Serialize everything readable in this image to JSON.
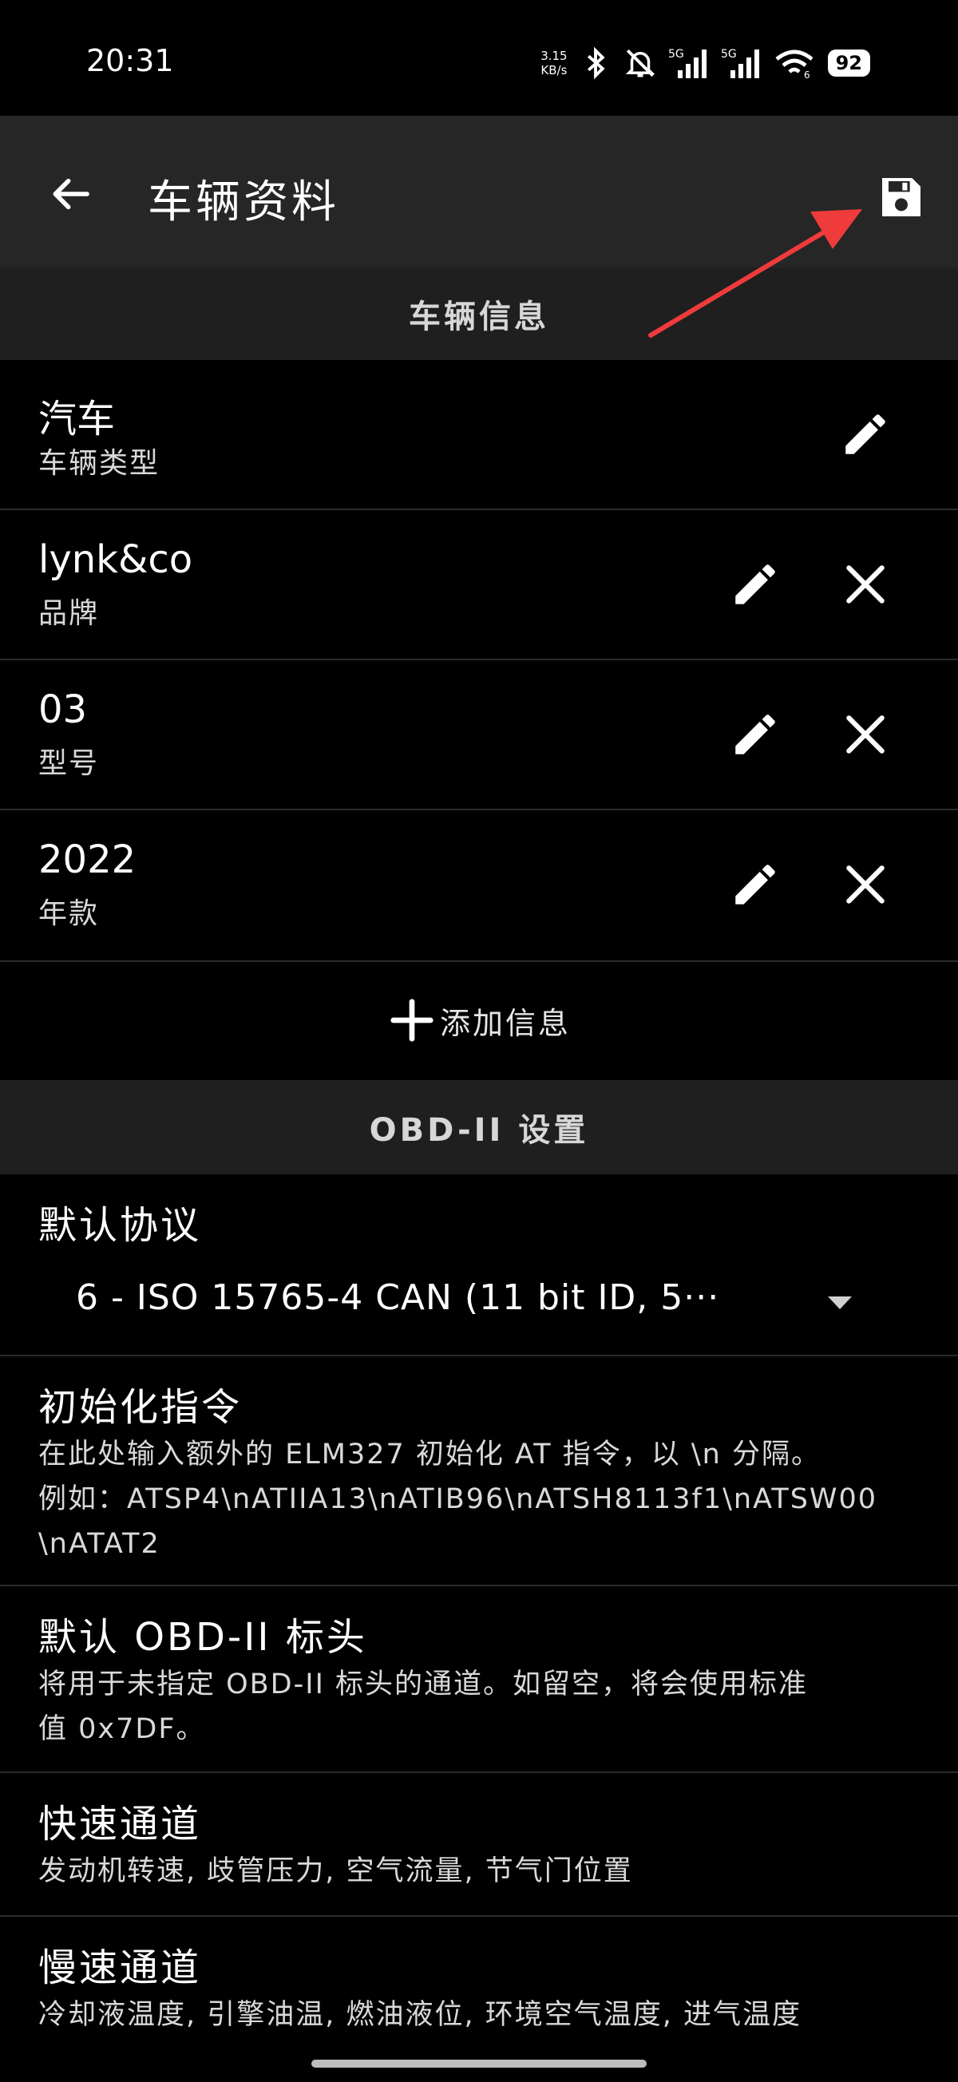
{
  "status_bar": {
    "time": "20:31",
    "net_speed_value": "3.15",
    "net_speed_unit": "KB/s",
    "network_1": "5G",
    "network_2": "5G",
    "wifi_sub": "6",
    "battery": "92"
  },
  "app_bar": {
    "title": "车辆资料",
    "back_icon": "arrow-left-icon",
    "save_icon": "floppy-disk-icon"
  },
  "vehicle_section": {
    "header": "车辆信息",
    "rows": [
      {
        "value": "汽车",
        "label": "车辆类型"
      },
      {
        "value": "lynk&co",
        "label": "品牌"
      },
      {
        "value": "03",
        "label": "型号"
      },
      {
        "value": "2022",
        "label": "年款"
      }
    ],
    "add_label": "添加信息"
  },
  "obd_section": {
    "header": "OBD-II 设置",
    "protocol": {
      "title": "默认协议",
      "selected": "6 - ISO 15765-4 CAN (11 bit ID, 5···"
    },
    "init": {
      "title": "初始化指令",
      "desc_line1": "在此处输入额外的 ELM327 初始化 AT 指令，以 \\n 分隔。",
      "desc_line2": "例如：ATSP4\\nATIIA13\\nATIB96\\nATSH8113f1\\nATSW00",
      "desc_line3": "\\nATAT2"
    },
    "header_setting": {
      "title": "默认 OBD-II 标头",
      "desc_line1": "将用于未指定 OBD-II 标头的通道。如留空，将会使用标准",
      "desc_line2": "值 0x7DF。"
    },
    "fast": {
      "title": "快速通道",
      "desc": "发动机转速, 歧管压力, 空气流量, 节气门位置"
    },
    "slow": {
      "title": "慢速通道",
      "desc": "冷却液温度, 引擎油温, 燃油液位, 环境空气温度, 进气温度"
    }
  },
  "colors": {
    "background": "#000000",
    "app_bar": "#262626",
    "section_header": "#1f1f1f",
    "annotation_arrow": "#ef3b3b"
  }
}
